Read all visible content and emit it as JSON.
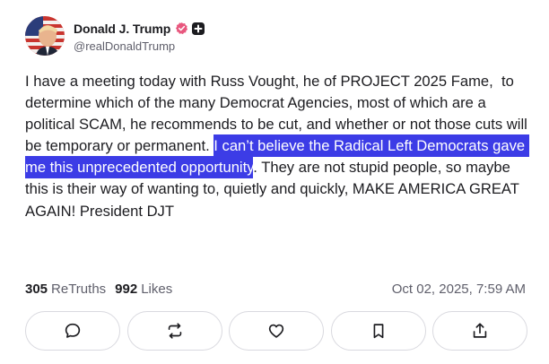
{
  "author": {
    "display_name": "Donald J. Trump",
    "handle": "@realDonaldTrump",
    "verified_icon": "verified-badge-icon",
    "extra_badge_icon": "plus-badge-icon"
  },
  "post": {
    "text_before": "I have a meeting today with Russ Vought, he of PROJECT 2025 Fame,  to determine which of the many Democrat Agencies, most of which are a political SCAM, he recommends to be cut, and whether or not those cuts will be temporary or permanent. ",
    "text_highlighted": "I can’t believe the Radical Left Democrats gave me this unprecedented opportunity",
    "text_after": ". They are not stupid people, so maybe this is their way of wanting to, quietly and quickly, MAKE AMERICA GREAT AGAIN! President DJT"
  },
  "stats": {
    "retruths_count": "305",
    "retruths_label": "ReTruths",
    "likes_count": "992",
    "likes_label": "Likes",
    "timestamp": "Oct 02, 2025, 7:59 AM"
  },
  "actions": [
    {
      "name": "reply",
      "icon": "comment-icon"
    },
    {
      "name": "retruth",
      "icon": "repost-icon"
    },
    {
      "name": "like",
      "icon": "heart-icon"
    },
    {
      "name": "bookmark",
      "icon": "bookmark-icon"
    },
    {
      "name": "share",
      "icon": "share-icon"
    }
  ],
  "colors": {
    "highlight": "#3c3ce6",
    "verified": "#e8577e",
    "text_primary": "#1c1c20",
    "text_secondary": "#5f5f6b",
    "button_border": "#d9d9df"
  }
}
